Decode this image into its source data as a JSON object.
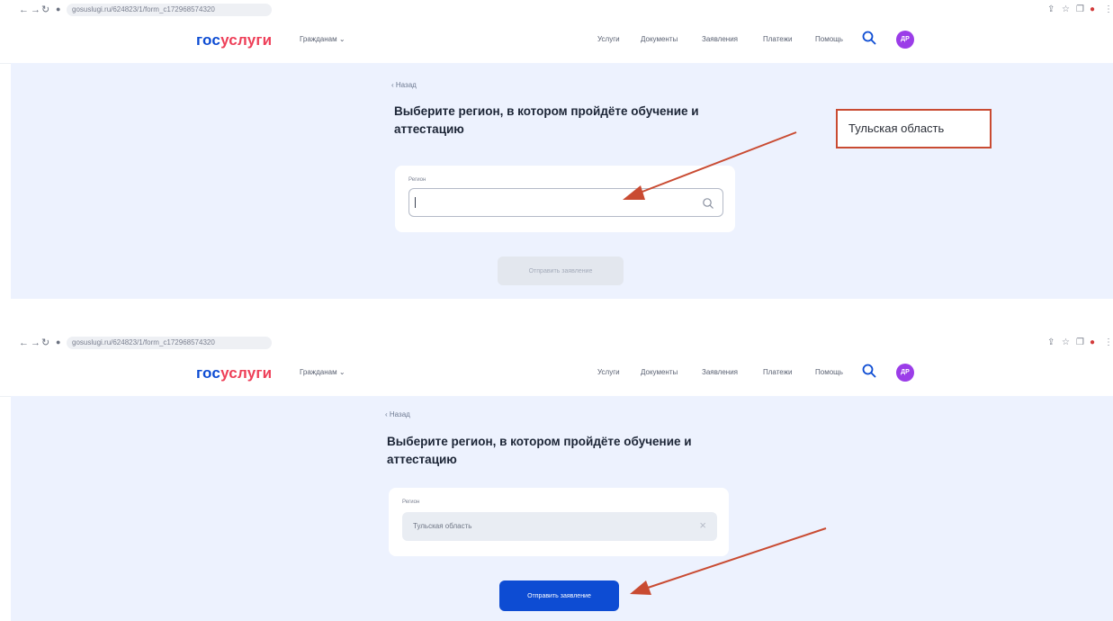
{
  "shots": [
    {
      "browser": {
        "url": "gosuslugi.ru/624823/1/form_c172968574320"
      },
      "header": {
        "logo_part1": "гос",
        "logo_part2": "услуги",
        "citizen_label": "Гражданам",
        "menu": [
          "Услуги",
          "Документы",
          "Заявления",
          "Платежи",
          "Помощь"
        ],
        "avatar_initials": "ДР"
      },
      "back_label": "‹ Назад",
      "heading": "Выберите регион, в котором пройдёте обучение и аттестацию",
      "field_label": "Регион",
      "field_value": "",
      "submit_label": "Отправить заявление",
      "submit_state": "disabled"
    },
    {
      "browser": {
        "url": "gosuslugi.ru/624823/1/form_c172968574320"
      },
      "header": {
        "logo_part1": "гос",
        "logo_part2": "услуги",
        "citizen_label": "Гражданам",
        "menu": [
          "Услуги",
          "Документы",
          "Заявления",
          "Платежи",
          "Помощь"
        ],
        "avatar_initials": "ДР"
      },
      "back_label": "‹ Назад",
      "heading": "Выберите регион, в котором пройдёте обучение и аттестацию",
      "field_label": "Регион",
      "field_value": "Тульская область",
      "submit_label": "Отправить заявление",
      "submit_state": "active"
    }
  ],
  "annotation": {
    "callout_text": "Тульская область",
    "arrow_color": "#c94b32"
  },
  "colors": {
    "brand_blue": "#0d4cd3",
    "brand_red": "#ee3f58",
    "avatar": "#9b3de8",
    "page_bg": "#edf2fe"
  }
}
